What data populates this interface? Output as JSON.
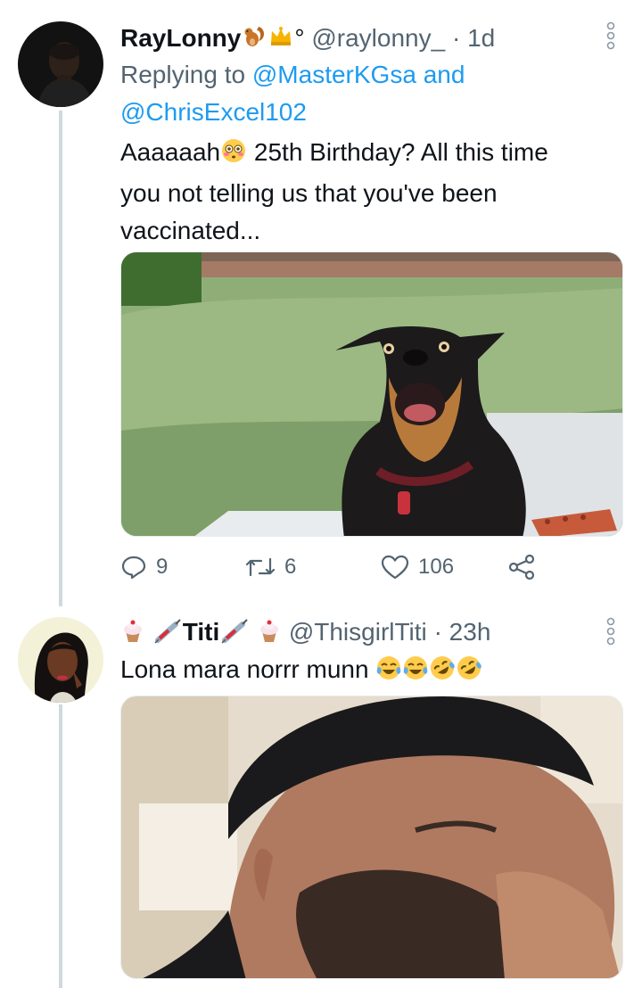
{
  "tweets": [
    {
      "name": "RayLonny",
      "name_emojis": [
        "squirrel-emoji",
        "crown-emoji"
      ],
      "name_suffix": "°",
      "handle": "@raylonny_",
      "separator": "·",
      "time": "1d",
      "replying_prefix": "Replying to",
      "replying_mention1": "@MasterKGsa",
      "replying_and": "and",
      "replying_mention2": "@ChrisExcel102",
      "text_line1_a": "Aaaaaah",
      "text_line1_b": " 25th Birthday? All this time",
      "text_line2": "you not telling us that you've been",
      "text_line3": "vaccinated...",
      "media_description_icon": "dog-photo",
      "actions": {
        "reply_count": "9",
        "retweet_count": "6",
        "like_count": "106"
      }
    },
    {
      "name": "Titi",
      "name_emojis": [
        "cupcake-emoji",
        "syringe-emoji",
        "syringe-emoji",
        "cupcake-emoji"
      ],
      "handle": "@ThisgirlTiti",
      "separator": "·",
      "time": "23h",
      "text": "Lona mara norrr munn",
      "text_emojis": [
        "tears-of-joy-emoji",
        "tears-of-joy-emoji",
        "rofl-emoji",
        "rofl-emoji"
      ],
      "media_description_icon": "laughing-man-photo"
    }
  ],
  "colors": {
    "accent": "#1d9bf0",
    "secondary_text": "#536471",
    "primary_text": "#0f1419",
    "thread_line": "#cfd9de"
  }
}
